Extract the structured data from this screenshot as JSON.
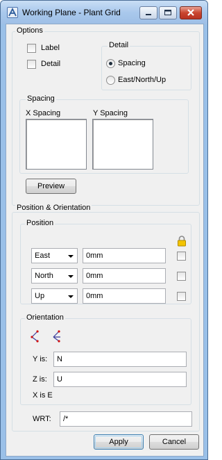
{
  "window": {
    "title": "Working Plane - Plant Grid"
  },
  "titlebar_buttons": {
    "minimize": "minimize-icon",
    "maximize": "maximize-icon",
    "close": "close-icon"
  },
  "options": {
    "group_label": "Options",
    "label_checkbox": {
      "label": "Label",
      "checked": false
    },
    "detail_checkbox": {
      "label": "Detail",
      "checked": false
    },
    "detail_group": {
      "label": "Detail",
      "radios": [
        {
          "label": "Spacing",
          "selected": true
        },
        {
          "label": "East/North/Up",
          "selected": false
        }
      ]
    },
    "spacing_group": {
      "label": "Spacing",
      "x_label": "X Spacing",
      "y_label": "Y Spacing"
    },
    "preview_button": "Preview"
  },
  "position_orientation": {
    "group_label": "Position & Orientation",
    "position": {
      "label": "Position",
      "lock_icon": "lock-icon",
      "rows": [
        {
          "axis": "East",
          "value": "0mm",
          "checked": false
        },
        {
          "axis": "North",
          "value": "0mm",
          "checked": false
        },
        {
          "axis": "Up",
          "value": "0mm",
          "checked": false
        }
      ]
    },
    "orientation": {
      "label": "Orientation",
      "icons": [
        "axes-pick-icon",
        "axes-align-icon"
      ],
      "y_label": "Y is:",
      "y_value": "N",
      "z_label": "Z is:",
      "z_value": "U",
      "x_text": "X is E"
    },
    "wrt_label": "WRT:",
    "wrt_value": "/*"
  },
  "buttons": {
    "apply": "Apply",
    "cancel": "Cancel"
  }
}
